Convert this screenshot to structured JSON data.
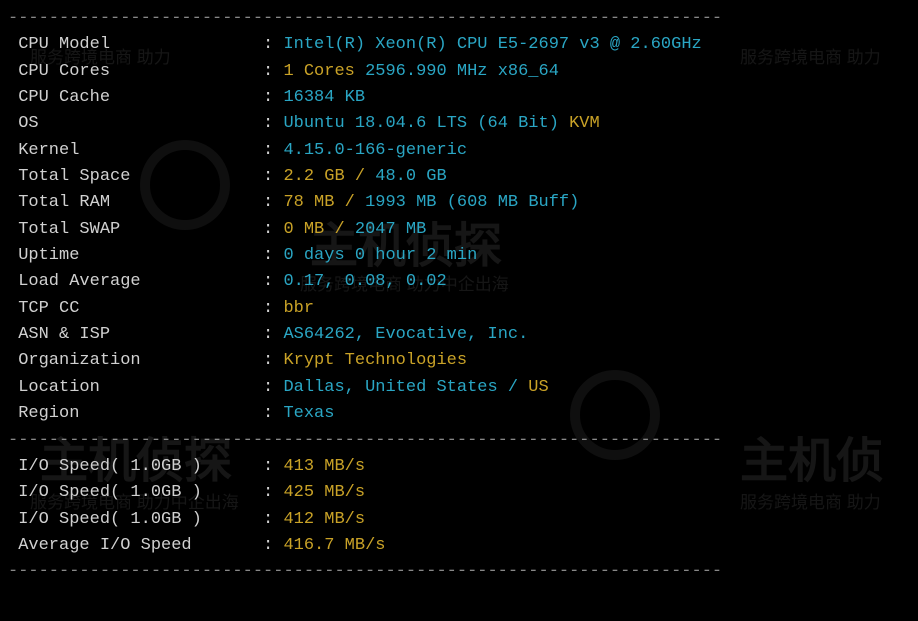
{
  "divider": "----------------------------------------------------------------------",
  "rows": [
    {
      "label": "CPU Model",
      "parts": [
        {
          "t": "Intel(R) Xeon(R) CPU E5-2697 v3 @ 2.60GHz",
          "c": "cyan"
        }
      ]
    },
    {
      "label": "CPU Cores",
      "parts": [
        {
          "t": "1 Cores ",
          "c": "yellow"
        },
        {
          "t": "2596.990 MHz ",
          "c": "cyan"
        },
        {
          "t": "x86_64",
          "c": "cyan"
        }
      ]
    },
    {
      "label": "CPU Cache",
      "parts": [
        {
          "t": "16384 KB",
          "c": "cyan"
        }
      ]
    },
    {
      "label": "OS",
      "parts": [
        {
          "t": "Ubuntu 18.04.6 LTS (64 Bit) ",
          "c": "cyan"
        },
        {
          "t": "KVM",
          "c": "yellow"
        }
      ]
    },
    {
      "label": "Kernel",
      "parts": [
        {
          "t": "4.15.0-166-generic",
          "c": "cyan"
        }
      ]
    },
    {
      "label": "Total Space",
      "parts": [
        {
          "t": "2.2 GB / ",
          "c": "yellow"
        },
        {
          "t": "48.0 GB",
          "c": "cyan"
        }
      ]
    },
    {
      "label": "Total RAM",
      "parts": [
        {
          "t": "78 MB / ",
          "c": "yellow"
        },
        {
          "t": "1993 MB ",
          "c": "cyan"
        },
        {
          "t": "(608 MB Buff)",
          "c": "cyan"
        }
      ]
    },
    {
      "label": "Total SWAP",
      "parts": [
        {
          "t": "0 MB / ",
          "c": "yellow"
        },
        {
          "t": "2047 MB",
          "c": "cyan"
        }
      ]
    },
    {
      "label": "Uptime",
      "parts": [
        {
          "t": "0 days 0 hour 2 min",
          "c": "cyan"
        }
      ]
    },
    {
      "label": "Load Average",
      "parts": [
        {
          "t": "0.17, 0.08, 0.02",
          "c": "cyan"
        }
      ]
    },
    {
      "label": "TCP CC",
      "parts": [
        {
          "t": "bbr",
          "c": "yellow"
        }
      ]
    },
    {
      "label": "ASN & ISP",
      "parts": [
        {
          "t": "AS64262, Evocative, Inc.",
          "c": "cyan"
        }
      ]
    },
    {
      "label": "Organization",
      "parts": [
        {
          "t": "Krypt Technologies",
          "c": "yellow"
        }
      ]
    },
    {
      "label": "Location",
      "parts": [
        {
          "t": "Dallas, United States / ",
          "c": "cyan"
        },
        {
          "t": "US",
          "c": "yellow"
        }
      ]
    },
    {
      "label": "Region",
      "parts": [
        {
          "t": "Texas",
          "c": "cyan"
        }
      ]
    }
  ],
  "io_rows": [
    {
      "label": "I/O Speed( 1.0GB )",
      "parts": [
        {
          "t": "413 MB/s",
          "c": "yellow"
        }
      ]
    },
    {
      "label": "I/O Speed( 1.0GB )",
      "parts": [
        {
          "t": "425 MB/s",
          "c": "yellow"
        }
      ]
    },
    {
      "label": "I/O Speed( 1.0GB )",
      "parts": [
        {
          "t": "412 MB/s",
          "c": "yellow"
        }
      ]
    },
    {
      "label": "Average I/O Speed",
      "parts": [
        {
          "t": "416.7 MB/s",
          "c": "yellow"
        }
      ]
    }
  ],
  "watermarks": {
    "big1": "主机侦探",
    "small1": "服务跨境电商 助力中企出海",
    "big2": "主机侦探",
    "small2": "服务跨境电商 助力中企出海",
    "big3": "主机侦",
    "small3": "服务跨境电商 助力",
    "small4": "服务跨境电商 助力"
  }
}
